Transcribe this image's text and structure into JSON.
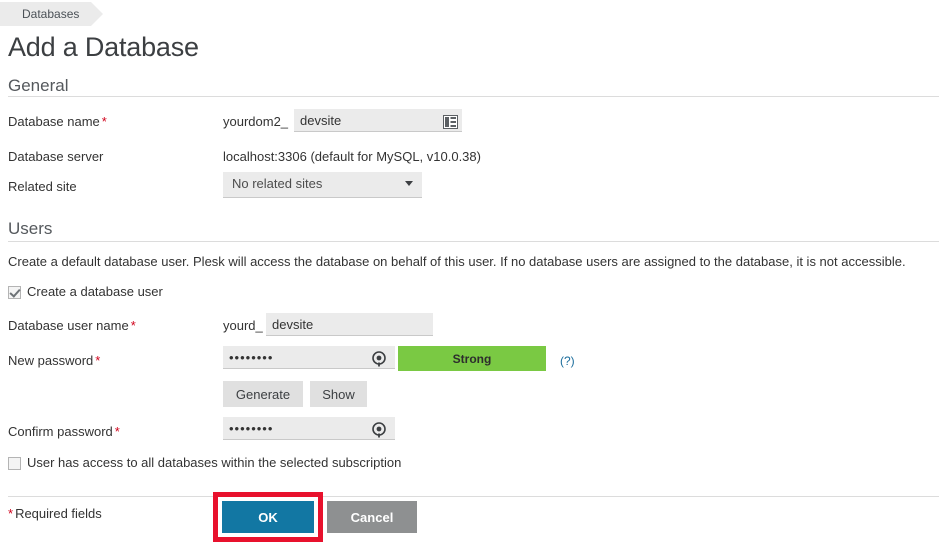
{
  "breadcrumb": {
    "items": [
      {
        "label": "Databases"
      }
    ]
  },
  "page": {
    "title": "Add a Database"
  },
  "sections": {
    "general": {
      "title": "General"
    },
    "users": {
      "title": "Users",
      "description": "Create a default database user. Plesk will access the database on behalf of this user. If no database users are assigned to the database, it is not accessible."
    }
  },
  "fields": {
    "database_name": {
      "label": "Database name",
      "required_marker": "*",
      "prefix": "yourdom2_",
      "value": "devsite",
      "placeholder": "",
      "icon": "database-table-icon"
    },
    "database_server": {
      "label": "Database server",
      "value": "localhost:3306 (default for MySQL, v10.0.38)"
    },
    "related_site": {
      "label": "Related site",
      "selected": "No related sites",
      "options": [
        "No related sites"
      ],
      "arrow_icon": "chevron-down-icon"
    },
    "create_user_checkbox": {
      "label": "Create a database user",
      "checked": true
    },
    "database_user_name": {
      "label": "Database user name",
      "required_marker": "*",
      "prefix": "yourd_",
      "value": "devsite",
      "placeholder": ""
    },
    "new_password": {
      "label": "New password",
      "required_marker": "*",
      "value": "••••••••",
      "reveal_icon": "show-password-icon",
      "strength_label": "Strong",
      "strength_color": "#7ac943",
      "hint_label": "(?)"
    },
    "generate_button": {
      "label": "Generate"
    },
    "show_button": {
      "label": "Show"
    },
    "confirm_password": {
      "label": "Confirm password",
      "required_marker": "*",
      "value": "••••••••",
      "reveal_icon": "show-password-icon"
    },
    "all_databases_checkbox": {
      "label": "User has access to all databases within the selected subscription",
      "checked": false
    }
  },
  "footer": {
    "required_marker": "*",
    "required_note": "Required fields",
    "ok_label": "OK",
    "cancel_label": "Cancel",
    "highlight_color": "#e8112d",
    "ok_color": "#1277a3"
  }
}
